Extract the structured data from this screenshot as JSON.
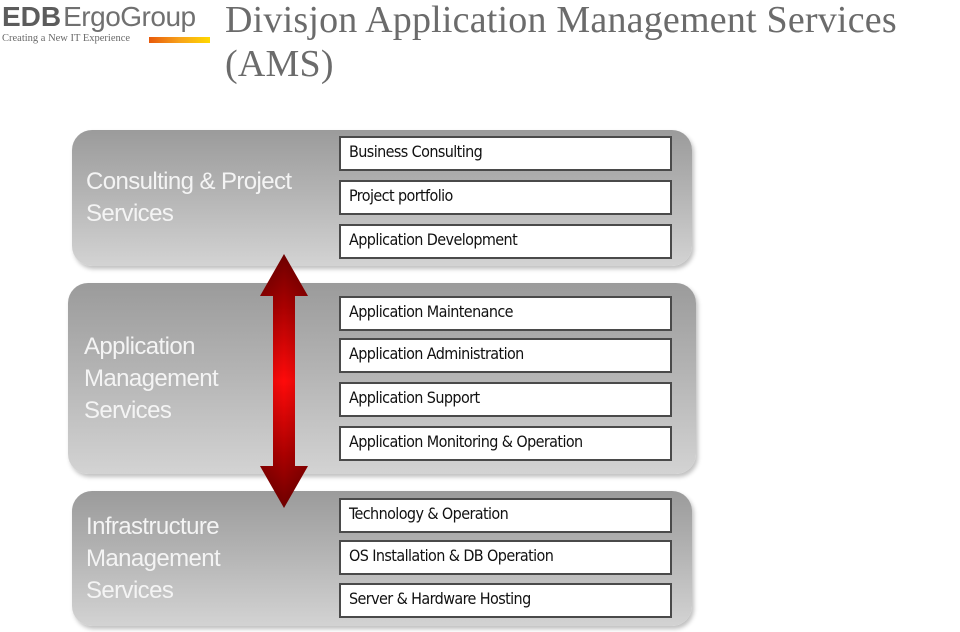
{
  "logo": {
    "brand_bold": "EDB",
    "brand_light": "ErgoGroup",
    "tagline": "Creating a New IT Experience",
    "bar_colors": [
      "#e85a0c",
      "#ffd800"
    ]
  },
  "title": "Divisjon Application Management Services (AMS)",
  "colors": {
    "title_text": "#6b6b6b",
    "panel_top": "#9b9b9b",
    "panel_bottom": "#d3d3d3",
    "panel_label": "#f4f4f4",
    "box_border": "#4a4a4a",
    "arrow_dark": "#7a0000",
    "arrow_bright": "#ff0000"
  },
  "arrow": {
    "icon": "double-headed-vertical-arrow",
    "direction": "up-down"
  },
  "panels": [
    {
      "label": "Consulting & Project\nServices",
      "services": [
        "Business Consulting",
        "Project portfolio",
        "Application Development"
      ]
    },
    {
      "label": "Application\nManagement\nServices",
      "services": [
        "Application Maintenance",
        "Application Administration",
        "Application Support",
        "Application Monitoring & Operation"
      ]
    },
    {
      "label": "Infrastructure\nManagement\n Services",
      "services": [
        "Technology & Operation",
        "OS Installation & DB Operation",
        "Server & Hardware Hosting"
      ]
    }
  ]
}
